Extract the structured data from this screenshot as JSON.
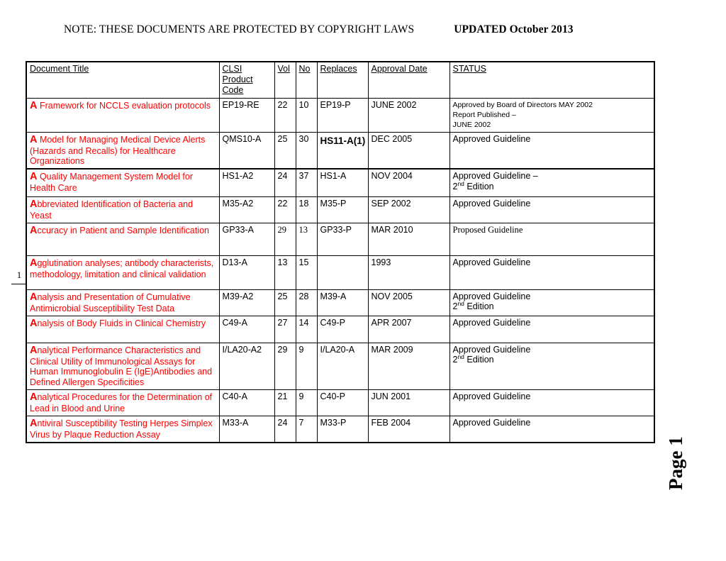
{
  "header": {
    "note": "NOTE:  THESE DOCUMENTS ARE PROTECTED BY COPYRIGHT LAWS",
    "updated": "UPDATED  October 2013"
  },
  "margin_mark": "1",
  "page_label": "Page 1",
  "colors": {
    "title_red": "#FF0000",
    "text_black": "#000000",
    "border": "#000000"
  },
  "table": {
    "columns": [
      {
        "key": "title",
        "label": "Document Title"
      },
      {
        "key": "code",
        "label": "CLSI",
        "label2": "Product",
        "label3": "Code"
      },
      {
        "key": "vol",
        "label": "Vol"
      },
      {
        "key": "no",
        "label": "No"
      },
      {
        "key": "replaces",
        "label": "Replaces"
      },
      {
        "key": "approval",
        "label": "Approval Date"
      },
      {
        "key": "status",
        "label": "STATUS"
      }
    ],
    "rows": [
      {
        "initial": "A",
        "title": " Framework for NCCLS evaluation protocols",
        "code": "EP19-RE",
        "vol": "22",
        "no": "10",
        "replaces": "EP19-P",
        "approval": "JUNE 2002",
        "status_line1": "Approved by Board of Directors  MAY 2002",
        "status_line2": "Report Published –",
        "status_line3": "JUNE 2002"
      },
      {
        "initial": "A",
        "title": "  Model for Managing Medical Device Alerts (Hazards and Recalls) for Healthcare Organizations",
        "code": "QMS10-A",
        "vol": "25",
        "no": "30",
        "replaces": "HS11-A(1)",
        "approval": "DEC 2005",
        "status_line1": "Approved Guideline"
      },
      {
        "initial": "A",
        "title": "  Quality Management System Model for Health Care",
        "code": "HS1-A2",
        "vol": "24",
        "no": "37",
        "replaces": "HS1-A",
        "approval": "NOV 2004",
        "status_line1": "Approved Guideline –",
        "status_line2_pre": "2",
        "status_line2_sup": "nd",
        "status_line2_post": " Edition"
      },
      {
        "initial": "A",
        "title": "bbreviated Identification of Bacteria and Yeast",
        "code": "M35-A2",
        "vol": "22",
        "no": "18",
        "replaces": "M35-P",
        "approval": "SEP 2002",
        "status_line1": "Approved Guideline"
      },
      {
        "initial": "A",
        "title": "ccuracy in Patient and Sample Identification",
        "code": "GP33-A",
        "vol": "29",
        "no": "13",
        "replaces": "GP33-P",
        "approval": "MAR 2010",
        "status_line1": "Proposed Guideline"
      },
      {
        "initial": "A",
        "title": "gglutination analyses; antibody characterists, methodology, limitation and clinical validation",
        "code": "D13-A",
        "vol": "13",
        "no": "15",
        "replaces": "",
        "approval": "1993",
        "status_line1": "Approved Guideline"
      },
      {
        "initial": "A",
        "title": "nalysis and Presentation of Cumulative Antimicrobial Susceptibility Test Data",
        "code": "M39-A2",
        "vol": "25",
        "no": "28",
        "replaces": "M39-A",
        "approval": "NOV 2005",
        "status_line1": "Approved Guideline",
        "status_line2_pre": "2",
        "status_line2_sup": "nd",
        "status_line2_post": " Edition"
      },
      {
        "initial": "A",
        "title": "nalysis of Body Fluids in Clinical Chemistry",
        "code": "C49-A",
        "vol": "27",
        "no": "14",
        "replaces": "C49-P",
        "approval": "APR 2007",
        "status_line1": "Approved Guideline"
      },
      {
        "initial": "A",
        "title": "nalytical Performance Characteristics and Clinical Utility of Immunological Assays for Human Immunoglobulin E (IgE)Antibodies and Defined Allergen Specificities",
        "code": "I/LA20-A2",
        "vol": "29",
        "no": "9",
        "replaces": "I/LA20-A",
        "approval": "MAR 2009",
        "status_line1": "Approved Guideline",
        "status_line2_pre": "2",
        "status_line2_sup": "nd",
        "status_line2_post": " Edition"
      },
      {
        "initial": "A",
        "title": "nalytical Procedures for the Determination of Lead in Blood and Urine",
        "code": "C40-A",
        "vol": "21",
        "no": "9",
        "replaces": "C40-P",
        "approval": "JUN 2001",
        "status_line1": "Approved Guideline"
      },
      {
        "initial": "A",
        "title": "ntiviral Susceptibility Testing Herpes Simplex Virus by Plaque Reduction Assay",
        "code": "M33-A",
        "vol": "24",
        "no": "7",
        "replaces": "M33-P",
        "approval": "FEB 2004",
        "status_line1": "Approved Guideline"
      }
    ]
  }
}
